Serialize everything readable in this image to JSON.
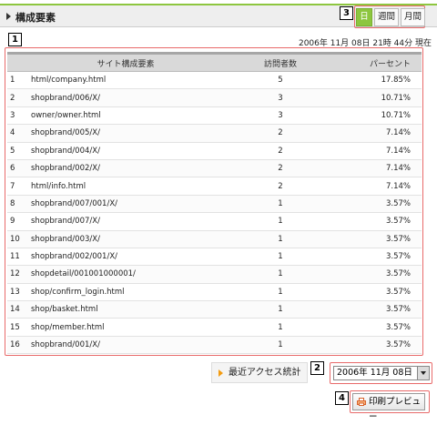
{
  "header": {
    "title": "構成要素"
  },
  "period_tabs": [
    {
      "label": "日",
      "active": true
    },
    {
      "label": "週間",
      "active": false
    },
    {
      "label": "月間",
      "active": false
    }
  ],
  "timestamp": "2006年 11月 08日 21時 44分 現在",
  "markers": {
    "m1": "1",
    "m2": "2",
    "m3": "3",
    "m4": "4"
  },
  "table": {
    "headers": {
      "element": "サイト構成要素",
      "visits": "訪問者数",
      "percent": "パーセント"
    },
    "rows": [
      {
        "no": "1",
        "path": "html/company.html",
        "visits": "5",
        "percent": "17.85%"
      },
      {
        "no": "2",
        "path": "shopbrand/006/X/",
        "visits": "3",
        "percent": "10.71%"
      },
      {
        "no": "3",
        "path": "owner/owner.html",
        "visits": "3",
        "percent": "10.71%"
      },
      {
        "no": "4",
        "path": "shopbrand/005/X/",
        "visits": "2",
        "percent": "7.14%"
      },
      {
        "no": "5",
        "path": "shopbrand/004/X/",
        "visits": "2",
        "percent": "7.14%"
      },
      {
        "no": "6",
        "path": "shopbrand/002/X/",
        "visits": "2",
        "percent": "7.14%"
      },
      {
        "no": "7",
        "path": "html/info.html",
        "visits": "2",
        "percent": "7.14%"
      },
      {
        "no": "8",
        "path": "shopbrand/007/001/X/",
        "visits": "1",
        "percent": "3.57%"
      },
      {
        "no": "9",
        "path": "shopbrand/007/X/",
        "visits": "1",
        "percent": "3.57%"
      },
      {
        "no": "10",
        "path": "shopbrand/003/X/",
        "visits": "1",
        "percent": "3.57%"
      },
      {
        "no": "11",
        "path": "shopbrand/002/001/X/",
        "visits": "1",
        "percent": "3.57%"
      },
      {
        "no": "12",
        "path": "shopdetail/001001000001/",
        "visits": "1",
        "percent": "3.57%"
      },
      {
        "no": "13",
        "path": "shop/confirm_login.html",
        "visits": "1",
        "percent": "3.57%"
      },
      {
        "no": "14",
        "path": "shop/basket.html",
        "visits": "1",
        "percent": "3.57%"
      },
      {
        "no": "15",
        "path": "shop/member.html",
        "visits": "1",
        "percent": "3.57%"
      },
      {
        "no": "16",
        "path": "shopbrand/001/X/",
        "visits": "1",
        "percent": "3.57%"
      }
    ]
  },
  "recent_stats": {
    "label": "最近アクセス統計"
  },
  "date_select": {
    "value": "2006年 11月 08日"
  },
  "print_button": {
    "label": "印刷プレビュー"
  },
  "colors": {
    "accent_green": "#8dc63f",
    "marker_red": "#e86a6a",
    "arrow_orange": "#f39c12"
  }
}
